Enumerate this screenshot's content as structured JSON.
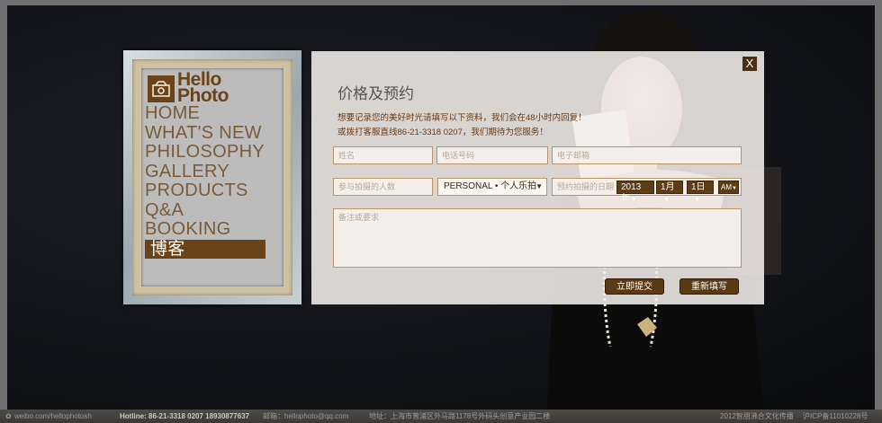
{
  "logo": {
    "line1": "Hello",
    "line2": "Photo"
  },
  "nav": [
    "HOME",
    "WHAT'S NEW",
    "PHILOSOPHY",
    "GALLERY",
    "PRODUCTS",
    "Q&A",
    "BOOKING",
    "博客"
  ],
  "modal": {
    "close_label": "X",
    "title": "价格及预约",
    "desc_line1": "想要记录您的美好时光请填写以下资料，我们会在48小时内回复！",
    "desc_line2": "或拨打客服直线86-21-3318 0207，我们期待为您服务！",
    "fields": {
      "name_placeholder": "姓名",
      "phone_placeholder": "电话号码",
      "email_placeholder": "电子邮箱",
      "people_placeholder": "参与拍摄的人数",
      "package_value": "PERSONAL • 个人乐拍",
      "date_label": "预约拍摄的日期",
      "year": "2013年",
      "month": "1月",
      "day": "1日",
      "ampm": "AM",
      "notes_placeholder": "备注或要求"
    },
    "submit_label": "立即提交",
    "reset_label": "重新填写"
  },
  "footer": {
    "weibo": "weibo.com/hellophotosh",
    "hotline": "Hotline: 86-21-3318 0207  18930877637",
    "email": "邮箱：hellophoto@qq.com",
    "address": "地址：上海市普浦区外马路1178号外码头创意产业园二楼",
    "copyright": "2012智朋沸合文化传播",
    "icp": "沪ICP备11010228号"
  },
  "colors": {
    "brand_brown": "#6a4318",
    "accent_text": "#6b3a12"
  }
}
